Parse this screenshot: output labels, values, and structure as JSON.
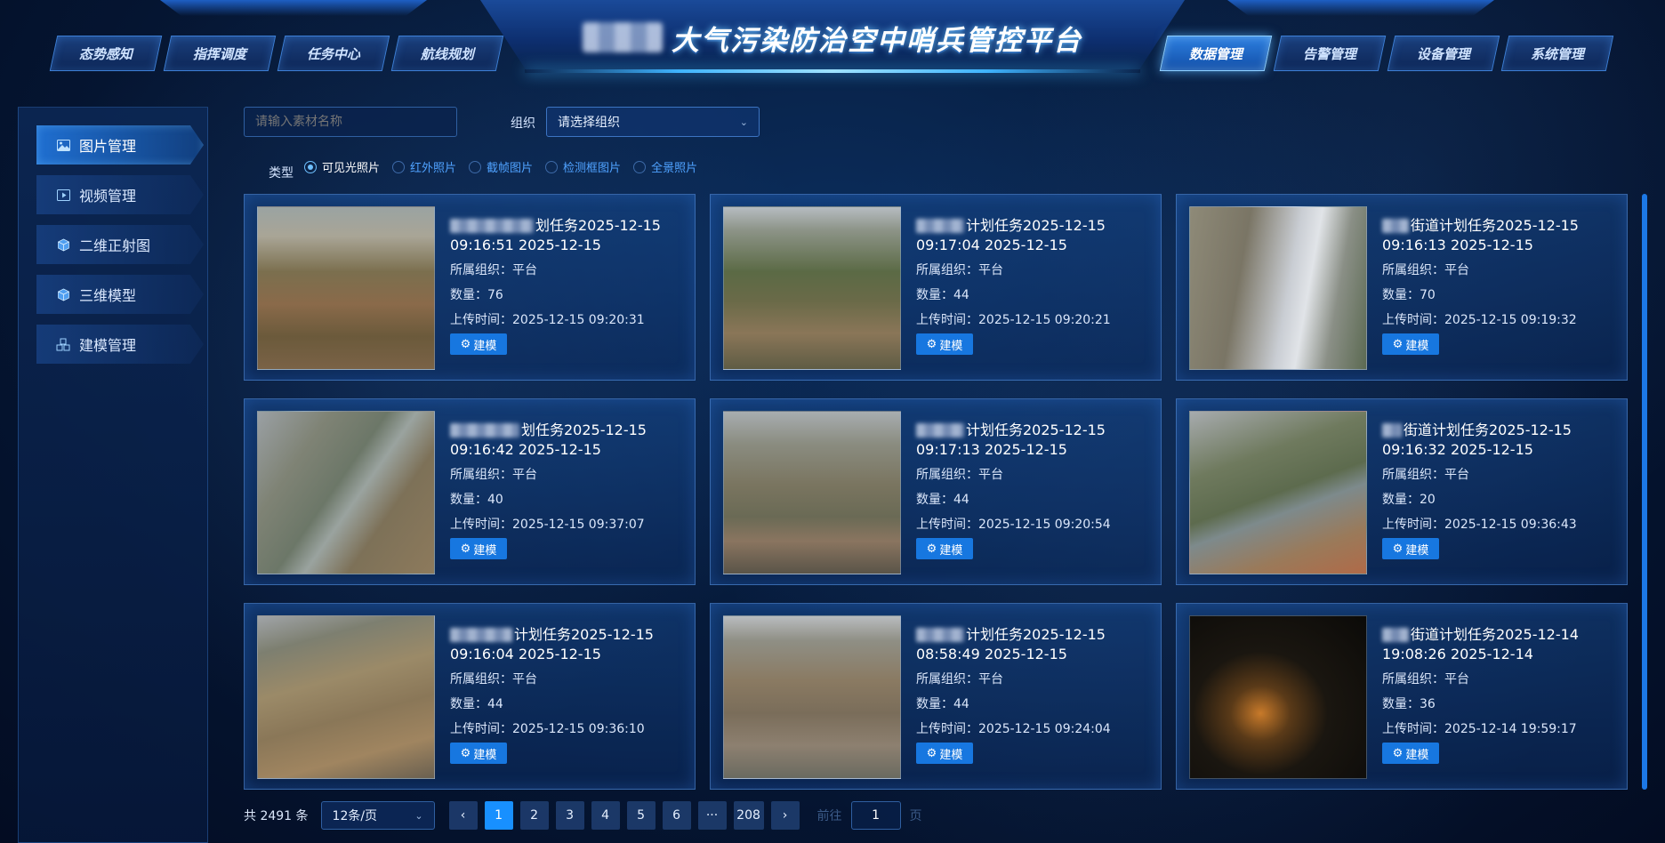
{
  "header": {
    "title": "大气污染防治空中哨兵管控平台",
    "nav_left": [
      "态势感知",
      "指挥调度",
      "任务中心",
      "航线规划"
    ],
    "nav_right": [
      "数据管理",
      "告警管理",
      "设备管理",
      "系统管理"
    ],
    "active_nav": "数据管理"
  },
  "sidebar": {
    "items": [
      {
        "label": "图片管理",
        "icon": "image-icon",
        "active": true
      },
      {
        "label": "视频管理",
        "icon": "video-icon",
        "active": false
      },
      {
        "label": "二维正射图",
        "icon": "cube-icon",
        "active": false
      },
      {
        "label": "三维模型",
        "icon": "cube-icon",
        "active": false
      },
      {
        "label": "建模管理",
        "icon": "cubes-icon",
        "active": false
      }
    ]
  },
  "filters": {
    "search_placeholder": "请输入素材名称",
    "org_label": "组织",
    "org_placeholder": "请选择组织",
    "type_label": "类型",
    "types": [
      "可见光照片",
      "红外照片",
      "截帧图片",
      "检测框图片",
      "全景照片"
    ],
    "selected_type": "可见光照片"
  },
  "cards": [
    {
      "title": "划任务2025-12-15",
      "time": "09:16:51 2025-12-15",
      "org": "所属组织：平台",
      "count": "数量：76",
      "upload": "上传时间：2025-12-15 09:20:31",
      "button": "建模"
    },
    {
      "title": "计划任务2025-12-15",
      "time": "09:17:04 2025-12-15",
      "org": "所属组织：平台",
      "count": "数量：44",
      "upload": "上传时间：2025-12-15 09:20:21",
      "button": "建模"
    },
    {
      "title": "街道计划任务2025-12-15",
      "time": "09:16:13 2025-12-15",
      "org": "所属组织：平台",
      "count": "数量：70",
      "upload": "上传时间：2025-12-15 09:19:32",
      "button": "建模"
    },
    {
      "title": "划任务2025-12-15",
      "time": "09:16:42 2025-12-15",
      "org": "所属组织：平台",
      "count": "数量：40",
      "upload": "上传时间：2025-12-15 09:37:07",
      "button": "建模"
    },
    {
      "title": "计划任务2025-12-15",
      "time": "09:17:13 2025-12-15",
      "org": "所属组织：平台",
      "count": "数量：44",
      "upload": "上传时间：2025-12-15 09:20:54",
      "button": "建模"
    },
    {
      "title": "街道计划任务2025-12-15",
      "time": "09:16:32 2025-12-15",
      "org": "所属组织：平台",
      "count": "数量：20",
      "upload": "上传时间：2025-12-15 09:36:43",
      "button": "建模"
    },
    {
      "title": "计划任务2025-12-15",
      "time": "09:16:04 2025-12-15",
      "org": "所属组织：平台",
      "count": "数量：44",
      "upload": "上传时间：2025-12-15 09:36:10",
      "button": "建模"
    },
    {
      "title": "计划任务2025-12-15",
      "time": "08:58:49 2025-12-15",
      "org": "所属组织：平台",
      "count": "数量：44",
      "upload": "上传时间：2025-12-15 09:24:04",
      "button": "建模"
    },
    {
      "title": "街道计划任务2025-12-14",
      "time": "19:08:26 2025-12-14",
      "org": "所属组织：平台",
      "count": "数量：36",
      "upload": "上传时间：2025-12-14 19:59:17",
      "button": "建模"
    }
  ],
  "pagination": {
    "total": "共 2491 条",
    "page_size": "12条/页",
    "prev": "‹",
    "next": "›",
    "pages": [
      "1",
      "2",
      "3",
      "4",
      "5",
      "6",
      "···",
      "208"
    ],
    "current": "1",
    "goto_label": "前往",
    "goto_value": "1",
    "page_word": "页"
  },
  "colors": {
    "accent": "#1890ff",
    "background": "#061a3a",
    "card_border": "#5a96e6"
  }
}
